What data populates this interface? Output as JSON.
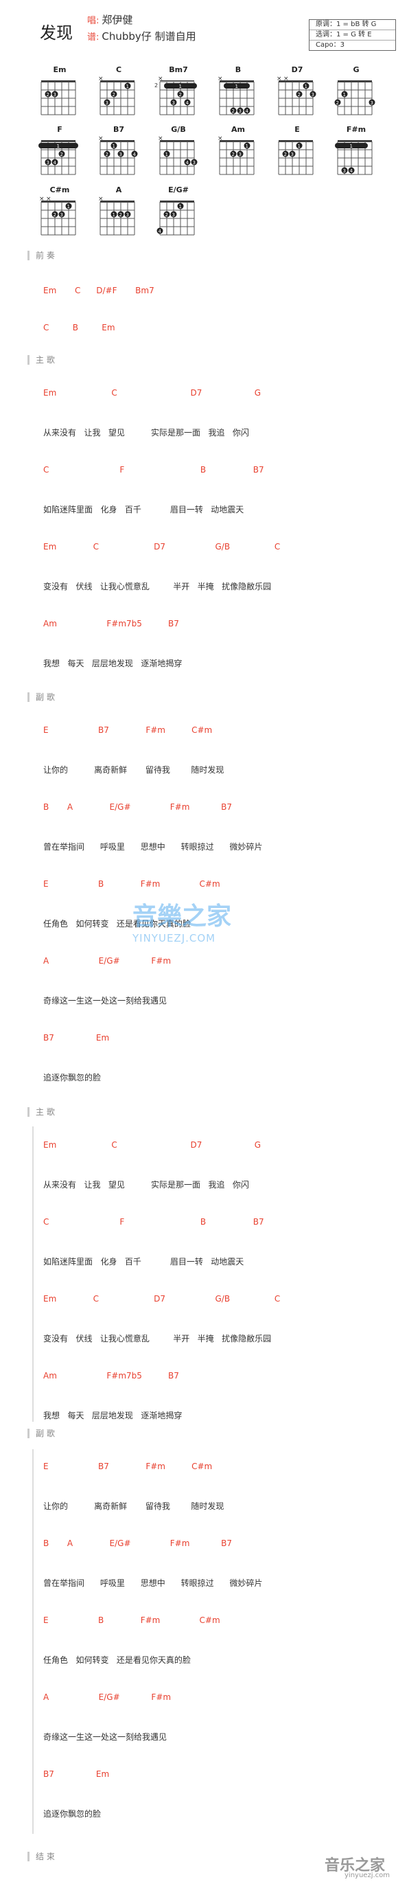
{
  "song": {
    "title": "发现",
    "singer_label": "唱:",
    "singer": "郑伊健",
    "arranger_label": "谱:",
    "arranger": "Chubby仔 制谱自用"
  },
  "key_info": [
    "原调：1 = bB 转 G",
    "选调：1 = G 转 E",
    "Capo：3"
  ],
  "chords": [
    {
      "name": "Em",
      "fret": null,
      "mutes": [],
      "barre": null,
      "dots": [
        [
          2,
          5,
          "2"
        ],
        [
          2,
          4,
          "3"
        ]
      ]
    },
    {
      "name": "C",
      "fret": null,
      "mutes": [
        6
      ],
      "barre": null,
      "dots": [
        [
          1,
          2,
          "1"
        ],
        [
          2,
          4,
          "2"
        ],
        [
          3,
          5,
          "3"
        ]
      ]
    },
    {
      "name": "Bm7",
      "fret": "2",
      "mutes": [
        6
      ],
      "barre": [
        1,
        5,
        1,
        "1"
      ],
      "dots": [
        [
          2,
          3,
          "2"
        ],
        [
          3,
          4,
          "3"
        ],
        [
          3,
          2,
          "4"
        ]
      ]
    },
    {
      "name": "B",
      "fret": null,
      "mutes": [
        6
      ],
      "barre": [
        2,
        5,
        1,
        "1"
      ],
      "dots": [
        [
          4,
          4,
          "2"
        ],
        [
          4,
          3,
          "3"
        ],
        [
          4,
          2,
          "4"
        ]
      ]
    },
    {
      "name": "D7",
      "fret": null,
      "mutes": [
        6,
        5
      ],
      "barre": null,
      "dots": [
        [
          1,
          2,
          "1"
        ],
        [
          2,
          3,
          "2"
        ],
        [
          2,
          1,
          "3"
        ]
      ]
    },
    {
      "name": "G",
      "fret": null,
      "mutes": [],
      "barre": null,
      "dots": [
        [
          2,
          5,
          "1"
        ],
        [
          3,
          6,
          "2"
        ],
        [
          3,
          1,
          "3"
        ]
      ]
    },
    {
      "name": "F",
      "fret": null,
      "mutes": [],
      "barre": [
        1,
        6,
        1,
        "1"
      ],
      "dots": [
        [
          2,
          3,
          "2"
        ],
        [
          3,
          5,
          "3"
        ],
        [
          3,
          4,
          "4"
        ]
      ]
    },
    {
      "name": "B7",
      "fret": null,
      "mutes": [
        6
      ],
      "barre": null,
      "dots": [
        [
          1,
          4,
          "1"
        ],
        [
          2,
          5,
          "2"
        ],
        [
          2,
          3,
          "3"
        ],
        [
          2,
          1,
          "4"
        ]
      ]
    },
    {
      "name": "G/B",
      "fret": null,
      "mutes": [
        6
      ],
      "barre": null,
      "dots": [
        [
          2,
          5,
          "1"
        ],
        [
          3,
          1,
          "3"
        ],
        [
          3,
          2,
          "4"
        ]
      ]
    },
    {
      "name": "Am",
      "fret": null,
      "mutes": [
        6
      ],
      "barre": null,
      "dots": [
        [
          1,
          2,
          "1"
        ],
        [
          2,
          4,
          "2"
        ],
        [
          2,
          3,
          "3"
        ]
      ]
    },
    {
      "name": "E",
      "fret": null,
      "mutes": [],
      "barre": null,
      "dots": [
        [
          1,
          3,
          "1"
        ],
        [
          2,
          5,
          "2"
        ],
        [
          2,
          4,
          "3"
        ]
      ]
    },
    {
      "name": "F#m",
      "fret": null,
      "mutes": [],
      "barre": [
        2,
        6,
        1,
        "1"
      ],
      "dots": [
        [
          4,
          5,
          "3"
        ],
        [
          4,
          4,
          "4"
        ]
      ]
    },
    {
      "name": "C#m",
      "fret": null,
      "mutes": [
        6,
        5
      ],
      "barre": null,
      "dots": [
        [
          1,
          2,
          "1"
        ],
        [
          2,
          4,
          "2"
        ],
        [
          2,
          3,
          "3"
        ]
      ]
    },
    {
      "name": "A",
      "fret": null,
      "mutes": [
        6
      ],
      "barre": null,
      "dots": [
        [
          2,
          4,
          "1"
        ],
        [
          2,
          3,
          "2"
        ],
        [
          2,
          2,
          "3"
        ]
      ]
    },
    {
      "name": "E/G#",
      "fret": null,
      "mutes": [],
      "barre": null,
      "dots": [
        [
          1,
          3,
          "1"
        ],
        [
          2,
          5,
          "2"
        ],
        [
          2,
          4,
          "3"
        ],
        [
          4,
          6,
          "4"
        ]
      ]
    }
  ],
  "sections": [
    {
      "label": "前 奏",
      "rows": [
        {
          "chords": "Em       C      D/#F       Bm7"
        },
        {
          "chords": "C         B         Em"
        }
      ]
    },
    {
      "label": "主 歌",
      "rows": [
        {
          "chords": "Em                     C                            D7                    G",
          "lyrics": "从来没有   让我   望见          实际是那一面   我追   你闪"
        },
        {
          "chords": "C                           F                             B                  B7",
          "lyrics": "如陷迷阵里面   化身   百千           眉目一转   动地震天"
        },
        {
          "chords": "Em              C                     D7                   G/B                 C",
          "lyrics": "变没有   伏线   让我心慌意乱         半开   半掩   扰像隐敝乐园"
        },
        {
          "chords": "Am                   F#m7b5          B7",
          "lyrics": "我想   每天   层层地发现   逐渐地揭穿"
        }
      ]
    },
    {
      "label": "副 歌",
      "rows": [
        {
          "chords": "E                   B7              F#m          C#m",
          "lyrics": "让你的          离奇新鲜       留待我        随时发现"
        },
        {
          "chords": "B       A              E/G#               F#m            B7",
          "lyrics": "曾在举指间      呼吸里      思想中      转眼掠过      微妙碎片"
        },
        {
          "chords": "E                   B              F#m               C#m",
          "lyrics": "任角色   如何转变   还是看见你天真的脸"
        },
        {
          "chords": "A                   E/G#            F#m",
          "lyrics": "奇缘这一生这一处这一刻给我遇见"
        },
        {
          "chords": "B7                Em",
          "lyrics": "追逐你飘忽的脸"
        }
      ]
    },
    {
      "label": "主 歌",
      "rows": [
        {
          "chords": "Em                     C                            D7                    G",
          "lyrics": "从来没有   让我   望见          实际是那一面   我追   你闪"
        },
        {
          "chords": "C                           F                             B                  B7",
          "lyrics": "如陷迷阵里面   化身   百千           眉目一转   动地震天"
        },
        {
          "chords": "Em              C                     D7                   G/B                 C",
          "lyrics": "变没有   伏线   让我心慌意乱         半开   半掩   扰像隐敝乐园"
        },
        {
          "chords": "Am                   F#m7b5          B7",
          "lyrics": "我想   每天   层层地发现   逐渐地揭穿"
        }
      ]
    },
    {
      "label": "副 歌",
      "rows": [
        {
          "chords": "E                   B7              F#m          C#m",
          "lyrics": "让你的          离奇新鲜       留待我        随时发现"
        },
        {
          "chords": "B       A              E/G#               F#m            B7",
          "lyrics": "曾在举指间      呼吸里      思想中      转眼掠过      微妙碎片"
        },
        {
          "chords": "E                   B              F#m               C#m",
          "lyrics": "任角色   如何转变   还是看见你天真的脸"
        },
        {
          "chords": "A                   E/G#            F#m",
          "lyrics": "奇缘这一生这一处这一刻给我遇见"
        },
        {
          "chords": "B7                Em",
          "lyrics": "追逐你飘忽的脸"
        }
      ]
    },
    {
      "label": "结 束",
      "rows": []
    }
  ],
  "watermark": {
    "text": "音樂之家",
    "url": "YINYUEZJ.COM"
  },
  "footer": {
    "logo": "音乐之家",
    "url": "yinyuezj.com"
  }
}
